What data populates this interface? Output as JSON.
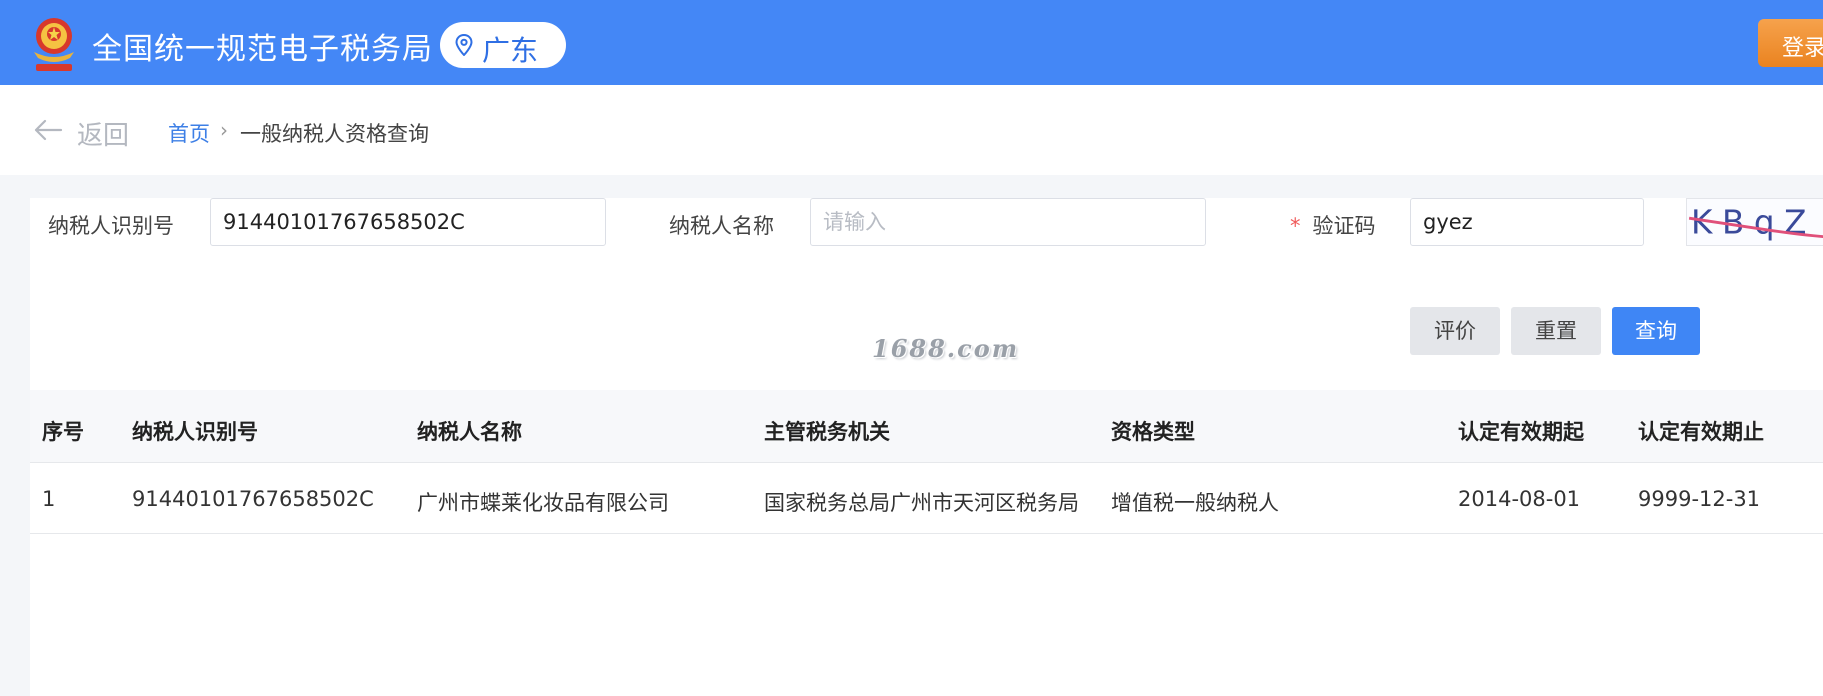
{
  "header": {
    "site_title": "全国统一规范电子税务局",
    "region": "广东",
    "login_label": "登录"
  },
  "nav": {
    "back_label": "返回",
    "breadcrumb_home": "首页",
    "breadcrumb_separator": "›",
    "breadcrumb_current": "一般纳税人资格查询"
  },
  "form": {
    "taxpayer_id_label": "纳税人识别号",
    "taxpayer_id_value": "91440101767658502C",
    "taxpayer_name_label": "纳税人名称",
    "taxpayer_name_value": "",
    "taxpayer_name_placeholder": "请输入",
    "captcha_required_mark": "*",
    "captcha_label": "验证码",
    "captcha_value": "gyez",
    "captcha_image_text": "KBqZ",
    "evaluate_label": "评价",
    "reset_label": "重置",
    "query_label": "查询"
  },
  "watermark": "1688.com",
  "table": {
    "columns": [
      "序号",
      "纳税人识别号",
      "纳税人名称",
      "主管税务机关",
      "资格类型",
      "认定有效期起",
      "认定有效期止"
    ],
    "rows": [
      [
        "1",
        "91440101767658502C",
        "广州市蝶莱化妆品有限公司",
        "国家税务总局广州市天河区税务局",
        "增值税一般纳税人",
        "2014-08-01",
        "9999-12-31"
      ]
    ]
  },
  "colors": {
    "header_bg": "#4487f6",
    "primary_button": "#3f86f5",
    "login_button": "#ea8320",
    "required_mark": "#f05a5a",
    "link": "#3d7fe6"
  }
}
